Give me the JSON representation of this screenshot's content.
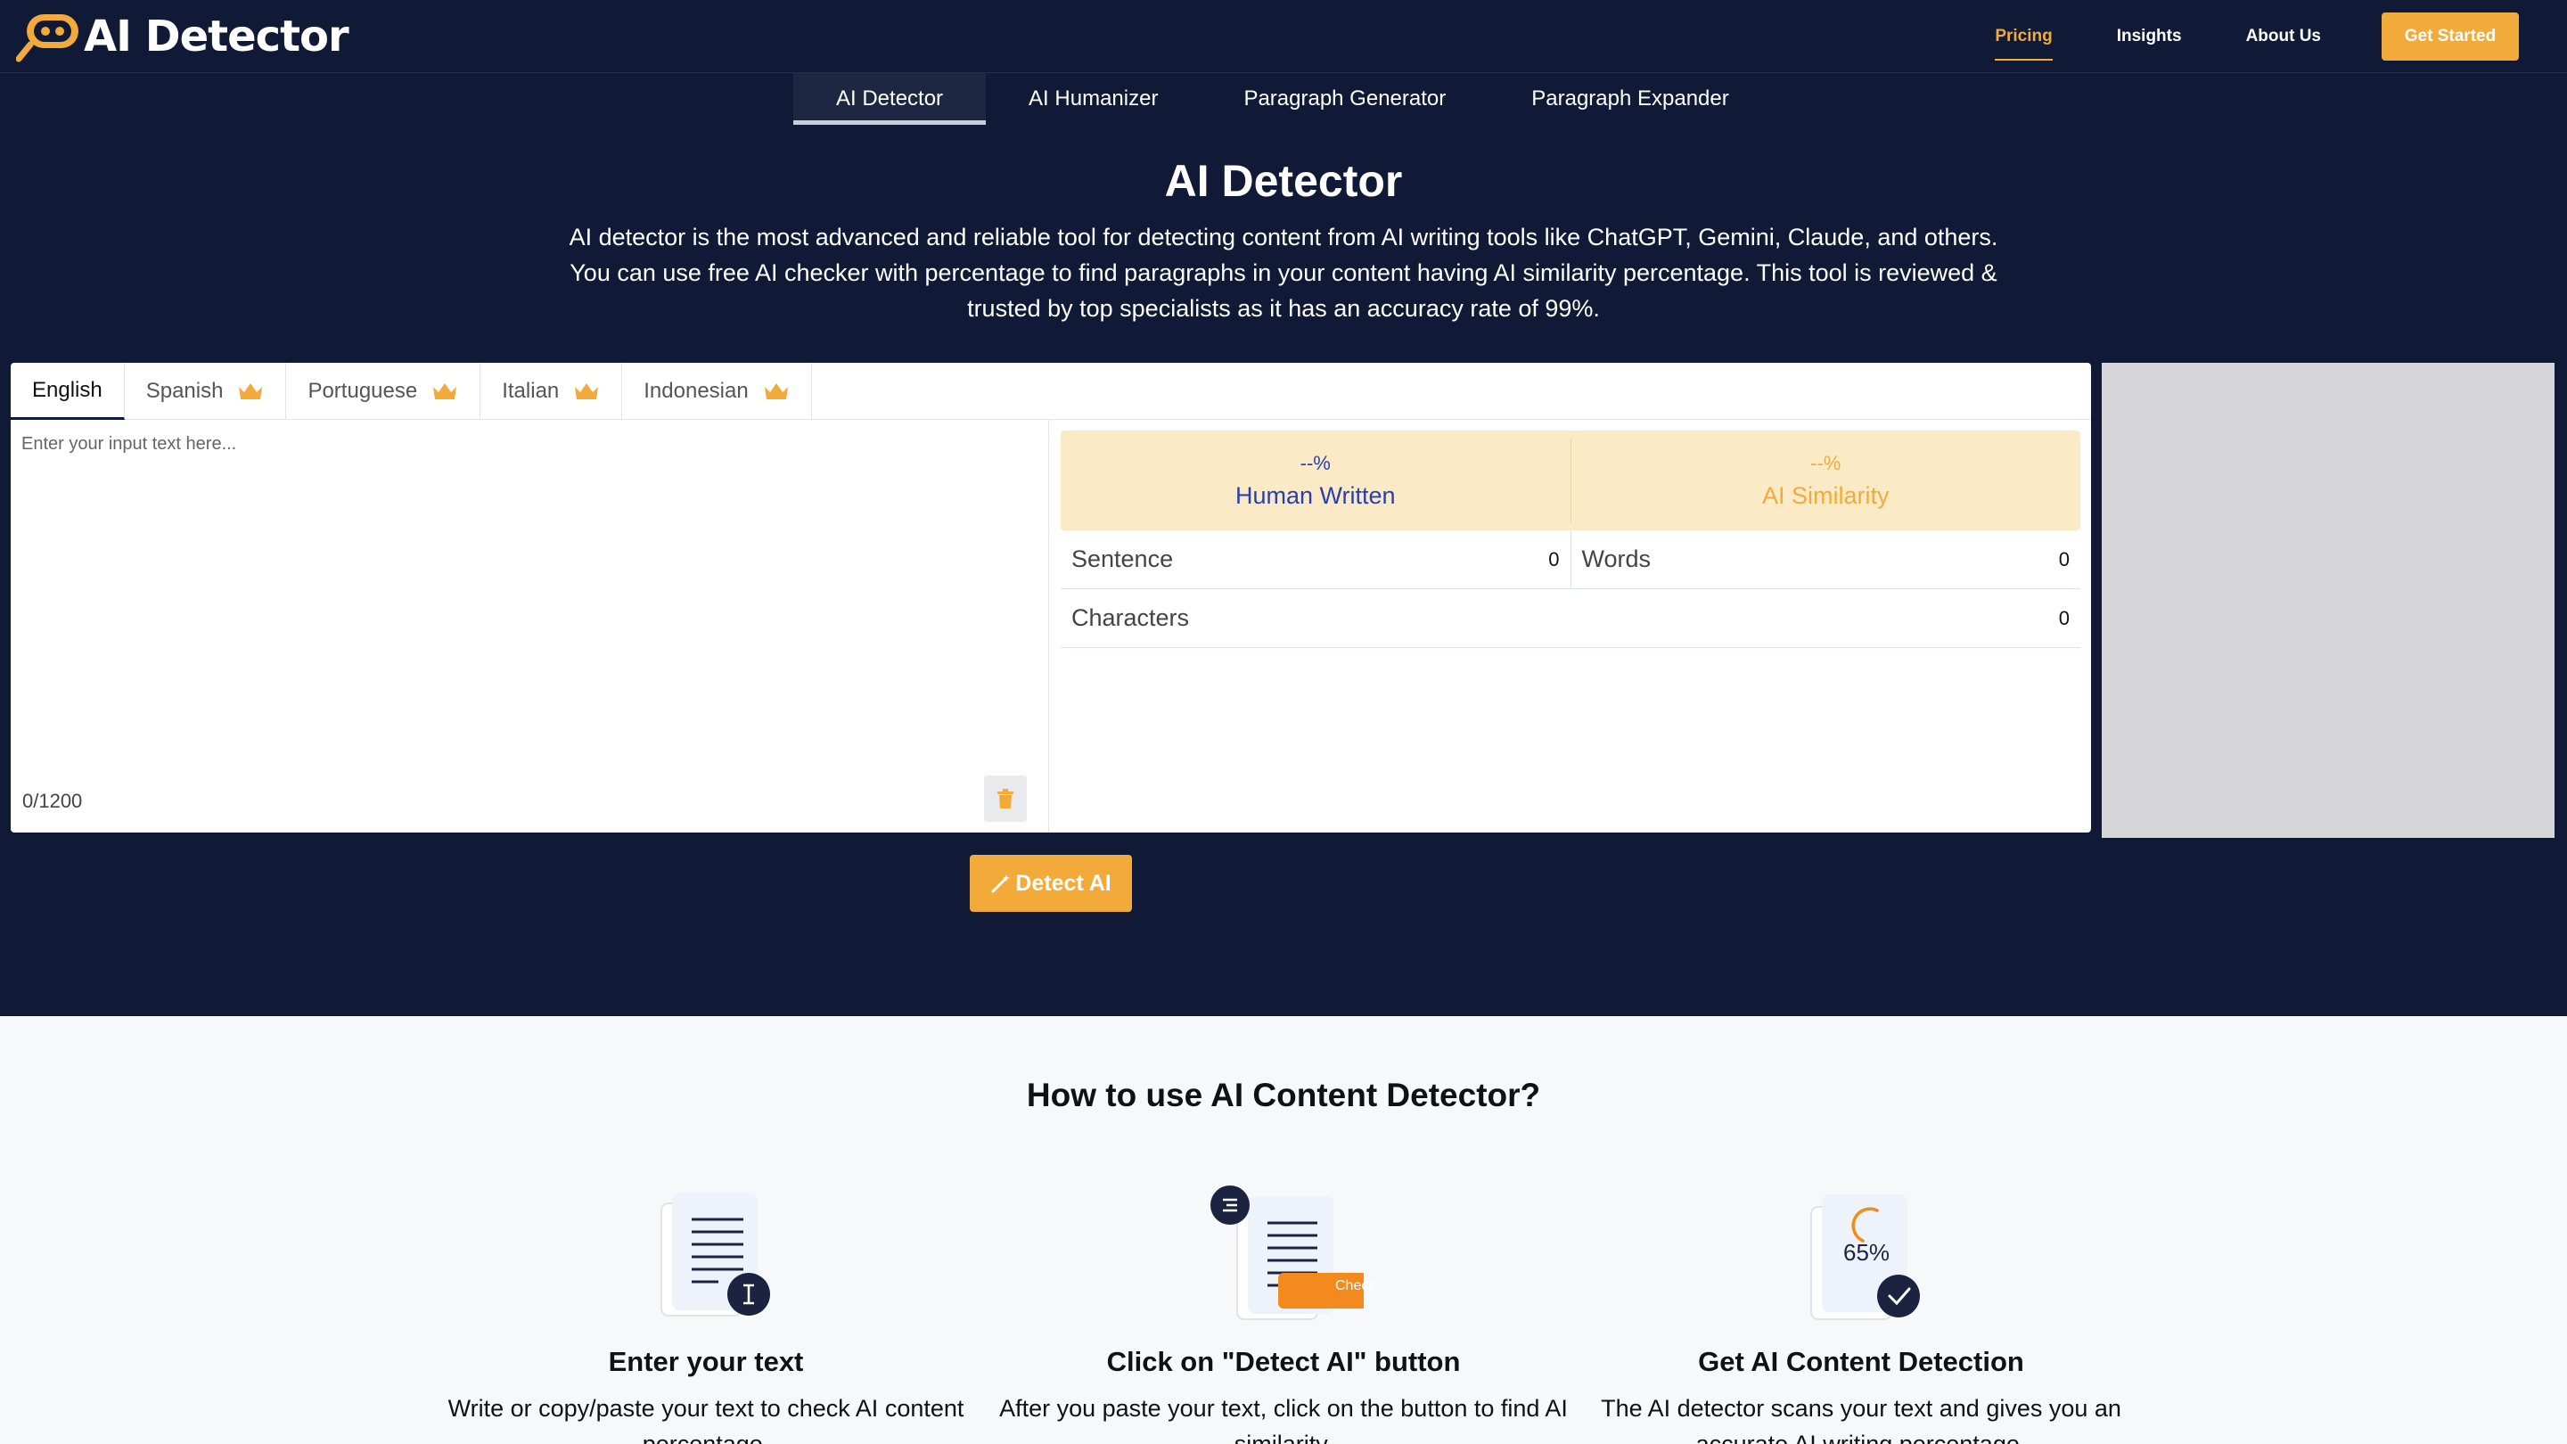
{
  "brand": {
    "name": "AI Detector"
  },
  "nav": {
    "links": [
      "Pricing",
      "Insights",
      "About Us"
    ],
    "cta": "Get Started"
  },
  "tools": [
    "AI Detector",
    "AI Humanizer",
    "Paragraph Generator",
    "Paragraph Expander"
  ],
  "hero": {
    "title": "AI Detector",
    "line1": "AI detector is the most advanced and reliable tool for detecting content from AI writing tools like ChatGPT, Gemini, Claude, and others.",
    "line2": "You can use free AI checker with percentage to find paragraphs in your content having AI similarity percentage. This tool is reviewed &",
    "line3": "trusted by top specialists as it has an accuracy rate of 99%."
  },
  "languages": [
    "English",
    "Spanish",
    "Portuguese",
    "Italian",
    "Indonesian"
  ],
  "input": {
    "placeholder": "Enter your input text here...",
    "counter": "0/1200"
  },
  "scores": {
    "human_value": "--%",
    "human_label": "Human Written",
    "ai_value": "--%",
    "ai_label": "AI Similarity"
  },
  "stats": {
    "sentence_label": "Sentence",
    "sentence_value": "0",
    "words_label": "Words",
    "words_value": "0",
    "characters_label": "Characters",
    "characters_value": "0"
  },
  "detect_button": "Detect AI",
  "howto": {
    "title": "How to use AI Content Detector?",
    "steps": [
      {
        "title": "Enter your text",
        "desc": "Write or copy/paste your text to check AI content percentage."
      },
      {
        "title": "Click on \"Detect AI\" button",
        "desc": "After you paste your text, click on the button to find AI similarity."
      },
      {
        "title": "Get AI Content Detection",
        "desc": "The AI detector scans your text and gives you an accurate AI writing percentage."
      }
    ],
    "check_label": "Check",
    "percent_label": "65%"
  },
  "colors": {
    "navy": "#101935",
    "accent": "#f2ab3a",
    "human": "#2a3fae",
    "score_bg": "#faebc6"
  }
}
